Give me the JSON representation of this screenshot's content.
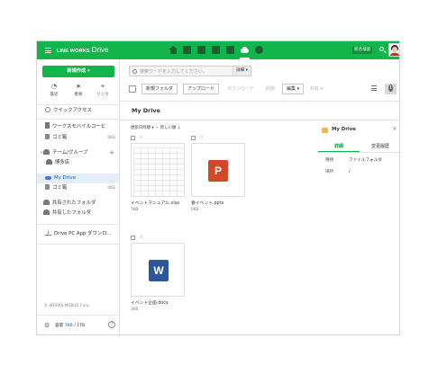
{
  "header": {
    "brand_main": "LINE WORKS",
    "brand_sub": "Drive",
    "app_icons": [
      "home-icon",
      "chat-icon",
      "mail-icon",
      "calendar-icon",
      "contacts-icon",
      "drive-icon",
      "notes-icon"
    ],
    "search_button_label": "統合検索"
  },
  "sidebar": {
    "new_button_label": "新規作成 ▾",
    "quick": [
      {
        "icon": "clock-icon",
        "label": "最近"
      },
      {
        "icon": "star-icon",
        "label": "重要"
      },
      {
        "icon": "link-icon",
        "label": "リンク"
      }
    ],
    "quick_access": "クイックアクセス",
    "mobile_folder": "ワークスモバイルコーヒ",
    "trash1_label": "ゴミ箱",
    "trash1_count": "0KB",
    "team_group": "チーム/グループ",
    "team_sub": "博多店",
    "my_drive": "My Drive",
    "trash2_label": "ゴミ箱",
    "trash2_count": "0KB",
    "shared_folder": "共有されたフォルダ",
    "sharing_folder": "共有したフォルダ",
    "drive_pc_app": "Drive PC App ダウンロ...",
    "footer": "© WORKS MOBILE Corp.",
    "capacity_label": "容量",
    "capacity_used": "7KB",
    "capacity_total": "/ 1TB"
  },
  "main": {
    "search_placeholder": "検索ワードを入力してください。",
    "search_detail": "詳細 ▾",
    "toolbar": {
      "new_folder": "新規フォルダ",
      "upload": "アップロード",
      "download": "ダウンロード",
      "delete": "削除",
      "edit": "編集 ▾",
      "share": "共有 ▾"
    },
    "page_title": "My Drive",
    "sort_label": "更新日時順 ▾ ・ 新しい順 ↓",
    "files": [
      {
        "name": "イベントマニュアル.xlsx",
        "size": "7KB",
        "type": "xlsx"
      },
      {
        "name": "春イベント.pptx",
        "size": "0KB",
        "type": "pptx"
      },
      {
        "name": "イベント企画.docx",
        "size": "3KB",
        "type": "docx"
      }
    ]
  },
  "panel": {
    "title": "My Drive",
    "tab_detail": "詳細",
    "tab_history": "変更履歴",
    "rows": [
      {
        "key": "種類",
        "value": "ファイルフォルダ"
      },
      {
        "key": "場所",
        "value": "/"
      }
    ]
  },
  "colors": {
    "brand_green": "#12b54a",
    "selected_blue": "#0d5fc4",
    "ppt_orange": "#d24726",
    "word_blue": "#2b579a"
  }
}
